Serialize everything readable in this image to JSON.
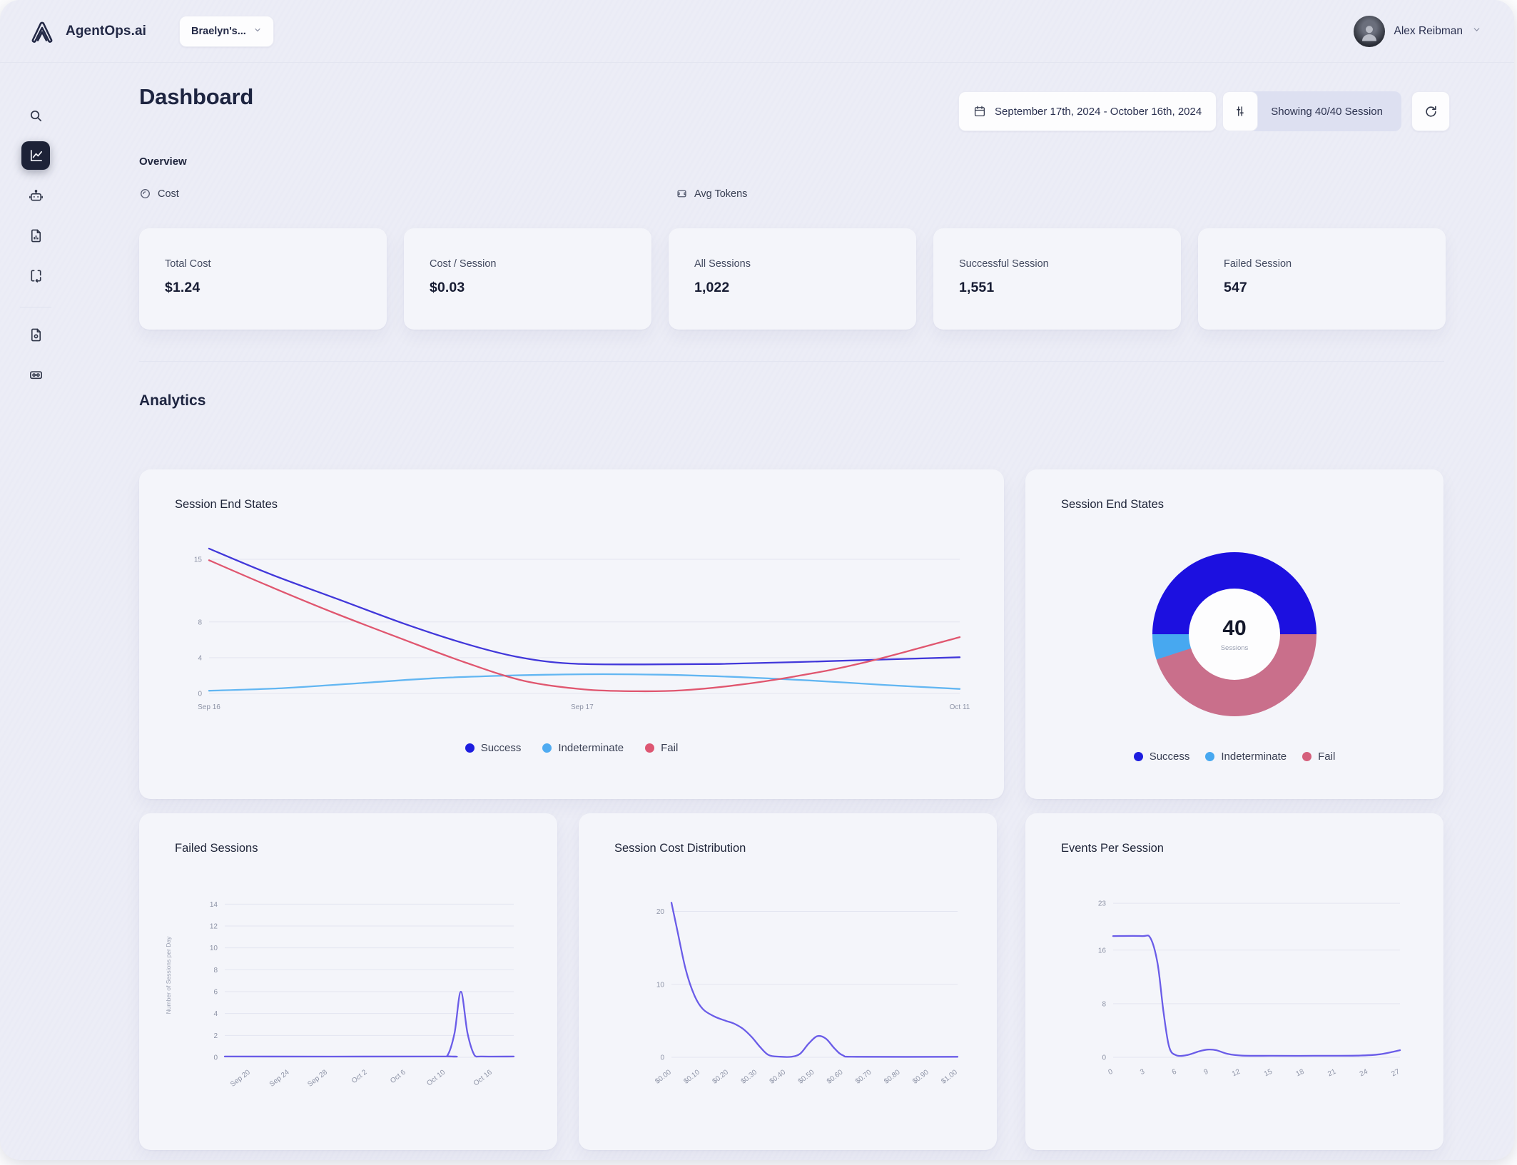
{
  "brand": {
    "name": "AgentOps.ai",
    "project": "Braelyn's..."
  },
  "user": {
    "name": "Alex Reibman"
  },
  "sidebar": {
    "icons": [
      "search",
      "line-chart",
      "bot",
      "file-chart",
      "code-brackets",
      "document",
      "id-card"
    ]
  },
  "header": {
    "title": "Dashboard",
    "date_range": "September 17th, 2024 - October 16th, 2024",
    "showing": "Showing 40/40 Session"
  },
  "overview": {
    "label": "Overview",
    "groups": [
      {
        "label": "Cost",
        "icon": "coin-icon"
      },
      {
        "label": "Avg Tokens",
        "icon": "token-icon"
      }
    ],
    "stats": [
      {
        "label": "Total Cost",
        "value": "$1.24"
      },
      {
        "label": "Cost / Session",
        "value": "$0.03"
      },
      {
        "label": "All Sessions",
        "value": "1,022"
      },
      {
        "label": "Successful Session",
        "value": "1,551"
      },
      {
        "label": "Failed Session",
        "value": "547"
      }
    ]
  },
  "analytics": {
    "label": "Analytics"
  },
  "colors": {
    "success": "#1d1ddf",
    "indeterminate": "#4fabf1",
    "fail": "#dd5672",
    "donut_success": "#1c10e0",
    "donut_fail": "#c96f8b",
    "donut_indeterminate": "#47a8f0",
    "purple_line": "#6a5ce8",
    "accent_dark": "#1d2237"
  },
  "chart_data": [
    {
      "id": "session-end-states-line",
      "type": "line",
      "title": "Session End States",
      "ylim": [
        0,
        16.6
      ],
      "y_ticks": [
        0,
        4,
        8,
        15
      ],
      "grid": true,
      "legend_position": "bottom",
      "x_ticks": [
        {
          "label": "Sep 16",
          "pos": 0
        },
        {
          "label": "Sep 17",
          "pos": 0.497
        },
        {
          "label": "Oct 11",
          "pos": 1
        }
      ],
      "legend": [
        {
          "label": "Success",
          "color": "#1d1ddf"
        },
        {
          "label": "Indeterminate",
          "color": "#4fabf1"
        },
        {
          "label": "Fail",
          "color": "#dd5672"
        }
      ],
      "series": [
        {
          "name": "Success",
          "color": "#4137da",
          "x": [
            0,
            0.08,
            0.17,
            0.26,
            0.34,
            0.41,
            0.48,
            0.58,
            0.68,
            0.78,
            0.88,
            1
          ],
          "y": [
            16.2,
            13.4,
            10.6,
            7.8,
            5.6,
            4.1,
            3.35,
            3.25,
            3.3,
            3.5,
            3.75,
            4.05
          ]
        },
        {
          "name": "Indeterminate",
          "color": "#62b6f2",
          "x": [
            0,
            0.1,
            0.2,
            0.3,
            0.4,
            0.5,
            0.6,
            0.7,
            0.8,
            0.9,
            1
          ],
          "y": [
            0.3,
            0.6,
            1.15,
            1.7,
            2.0,
            2.15,
            2.1,
            1.85,
            1.45,
            0.95,
            0.5
          ]
        },
        {
          "name": "Fail",
          "color": "#e0566f",
          "x": [
            0,
            0.08,
            0.17,
            0.26,
            0.34,
            0.42,
            0.5,
            0.57,
            0.63,
            0.7,
            0.78,
            0.87,
            1
          ],
          "y": [
            14.9,
            12.0,
            8.9,
            6.0,
            3.5,
            1.4,
            0.45,
            0.25,
            0.35,
            0.9,
            1.9,
            3.4,
            6.3
          ]
        }
      ]
    },
    {
      "id": "session-end-states-donut",
      "type": "donut",
      "title": "Session End States",
      "center_value": "40",
      "center_label": "Sessions",
      "slices": [
        {
          "label": "Success",
          "value": 50,
          "color": "#1c10e0"
        },
        {
          "label": "Fail",
          "value": 45,
          "color": "#c96f8b"
        },
        {
          "label": "Indeterminate",
          "value": 5,
          "color": "#47a8f0"
        }
      ],
      "legend": [
        {
          "label": "Success",
          "color": "#1d1ddf"
        },
        {
          "label": "Indeterminate",
          "color": "#47a8f0"
        },
        {
          "label": "Fail",
          "color": "#d5607c"
        }
      ]
    },
    {
      "id": "failed-sessions",
      "type": "line",
      "title": "Failed Sessions",
      "ylabel": "Number of Sessions per Day",
      "ylim": [
        0,
        15
      ],
      "y_ticks": [
        0,
        2,
        4,
        6,
        8,
        10,
        12,
        14
      ],
      "grid": true,
      "x_ticks": [
        {
          "label": "Sep 20",
          "pos": 0.089
        },
        {
          "label": "Sep 24",
          "pos": 0.224
        },
        {
          "label": "Sep 28",
          "pos": 0.356
        },
        {
          "label": "Oct 2",
          "pos": 0.493
        },
        {
          "label": "Oct 6",
          "pos": 0.627
        },
        {
          "label": "Oct 10",
          "pos": 0.764
        },
        {
          "label": "Oct 16",
          "pos": 0.926
        }
      ],
      "series": [
        {
          "name": "Failed Sessions",
          "color": "#6a5ce8",
          "x": [
            0,
            0.74,
            0.77,
            0.795,
            0.817,
            0.84,
            0.865,
            0.89,
            1
          ],
          "y": [
            0.07,
            0.07,
            0.15,
            2.2,
            6.0,
            2.2,
            0.15,
            0.07,
            0.07
          ]
        }
      ]
    },
    {
      "id": "session-cost-distribution",
      "type": "line",
      "title": "Session Cost Distribution",
      "ylim": [
        0,
        22.5
      ],
      "y_ticks": [
        0,
        10,
        20
      ],
      "grid": true,
      "x_ticks": [
        {
          "label": "$0.00",
          "pos": 0
        },
        {
          "label": "$0.10",
          "pos": 0.1
        },
        {
          "label": "$0.20",
          "pos": 0.2
        },
        {
          "label": "$0.30",
          "pos": 0.3
        },
        {
          "label": "$0.40",
          "pos": 0.4
        },
        {
          "label": "$0.50",
          "pos": 0.5
        },
        {
          "label": "$0.60",
          "pos": 0.6
        },
        {
          "label": "$0.70",
          "pos": 0.7
        },
        {
          "label": "$0.80",
          "pos": 0.8
        },
        {
          "label": "$0.90",
          "pos": 0.9
        },
        {
          "label": "$1.00",
          "pos": 1
        }
      ],
      "series": [
        {
          "name": "Sessions",
          "color": "#6a5ce8",
          "x": [
            0,
            0.02,
            0.05,
            0.08,
            0.11,
            0.15,
            0.19,
            0.22,
            0.25,
            0.28,
            0.31,
            0.34,
            0.38,
            0.42,
            0.45,
            0.48,
            0.51,
            0.54,
            0.57,
            0.6,
            0.65,
            1
          ],
          "y": [
            21.2,
            17.5,
            12.0,
            8.5,
            6.6,
            5.6,
            5.0,
            4.6,
            3.9,
            2.8,
            1.4,
            0.3,
            0.08,
            0.08,
            0.5,
            1.9,
            2.9,
            2.55,
            1.2,
            0.25,
            0.07,
            0.07
          ]
        }
      ]
    },
    {
      "id": "events-per-session",
      "type": "line",
      "title": "Events Per Session",
      "ylim": [
        0,
        24.5
      ],
      "y_ticks": [
        0,
        8,
        16,
        23
      ],
      "grid": true,
      "x_ticks": [
        {
          "label": "0",
          "pos": 0
        },
        {
          "label": "3",
          "pos": 0.111
        },
        {
          "label": "6",
          "pos": 0.222
        },
        {
          "label": "9",
          "pos": 0.333
        },
        {
          "label": "12",
          "pos": 0.444
        },
        {
          "label": "15",
          "pos": 0.556
        },
        {
          "label": "18",
          "pos": 0.667
        },
        {
          "label": "21",
          "pos": 0.778
        },
        {
          "label": "24",
          "pos": 0.889
        },
        {
          "label": "27",
          "pos": 1
        }
      ],
      "series": [
        {
          "name": "Events",
          "color": "#6a5ce8",
          "x": [
            0,
            0.1,
            0.13,
            0.155,
            0.175,
            0.195,
            0.22,
            0.26,
            0.3,
            0.33,
            0.36,
            0.4,
            0.45,
            0.55,
            0.7,
            0.85,
            0.93,
            1
          ],
          "y": [
            18.1,
            18.1,
            17.8,
            14.0,
            7.0,
            1.6,
            0.3,
            0.35,
            0.9,
            1.15,
            1.05,
            0.5,
            0.25,
            0.22,
            0.22,
            0.25,
            0.45,
            1.05
          ]
        }
      ]
    }
  ]
}
